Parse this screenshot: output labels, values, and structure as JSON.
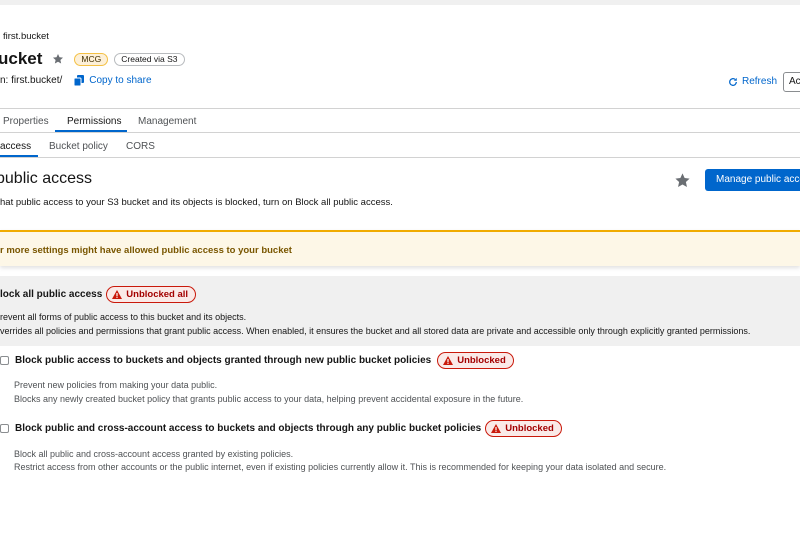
{
  "breadcrumb": "first.bucket",
  "header": {
    "title": "ucket",
    "badges": [
      "MCG",
      "Created via S3"
    ],
    "path_label": "n: first.bucket/",
    "copy_label": "Copy to share",
    "refresh_label": "Refresh",
    "actions_label": "Ac"
  },
  "tabs": [
    {
      "label": "Properties",
      "active": false
    },
    {
      "label": "Permissions",
      "active": true
    },
    {
      "label": "Management",
      "active": false
    }
  ],
  "subtabs": [
    {
      "label": "access",
      "active": true
    },
    {
      "label": "Bucket policy",
      "active": false
    },
    {
      "label": "CORS",
      "active": false
    }
  ],
  "section": {
    "title": "public access",
    "description": "hat public access to your S3 bucket and its objects is blocked, turn on Block all public access.",
    "manage_button": "Manage public access"
  },
  "warning": {
    "text": "r more settings might have allowed public access to your bucket"
  },
  "block_all": {
    "label": "lock all public access",
    "badge": "Unblocked all",
    "desc1": "revent all forms of public access to this bucket and its objects.",
    "desc2": "verrides all policies and permissions that grant public access. When enabled, it ensures the bucket and all stored data are private and accessible only through explicitly granted permissions."
  },
  "options": [
    {
      "label": "Block public access to buckets and objects granted through new public bucket policies",
      "badge": "Unblocked",
      "desc1": "Prevent new policies from making your data public.",
      "desc2": "Blocks any newly created bucket policy that grants public access to your data, helping prevent accidental exposure in the future."
    },
    {
      "label": "Block public and cross-account access to buckets and objects through any public bucket policies",
      "badge": "Unblocked",
      "desc1": "Block all public and cross-account access granted by existing policies.",
      "desc2": "Restrict access from other accounts or the public internet, even if existing policies currently allow it. This is recommended for keeping your data isolated and secure."
    }
  ],
  "colors": {
    "primary": "#0066cc",
    "danger": "#c9190b",
    "warning": "#f0ab00"
  }
}
